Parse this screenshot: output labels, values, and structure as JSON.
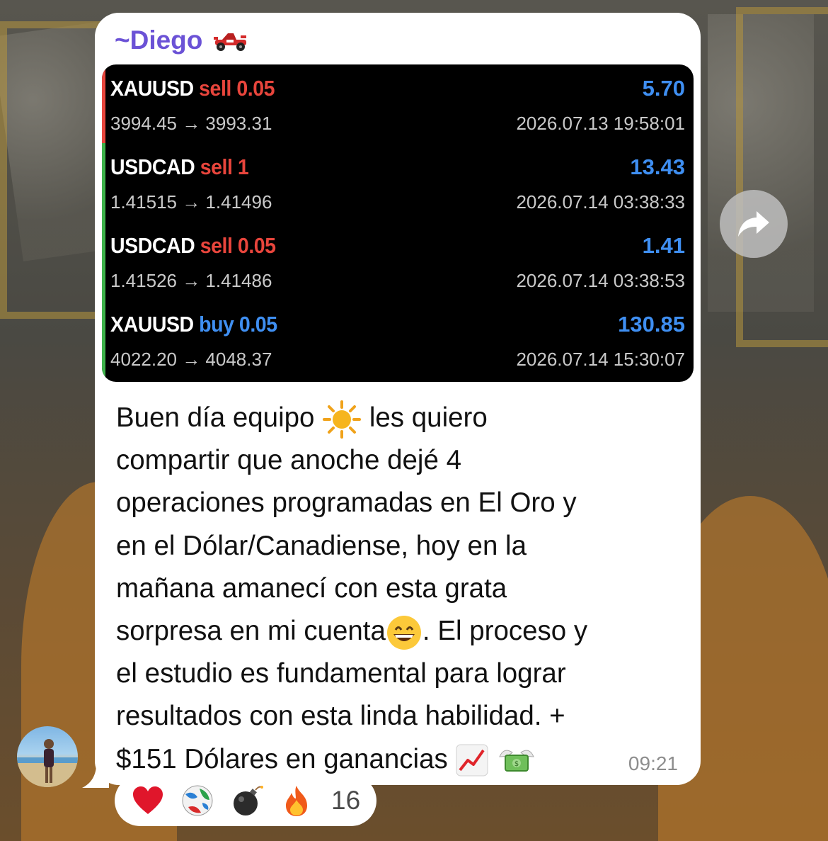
{
  "message": {
    "sender_prefix": "~",
    "sender": "Diego",
    "sender_emoji": "racing-car-icon",
    "time": "09:21",
    "text_lines": [
      "Buen día equipo ",
      " les quiero",
      "compartir que anoche dejé 4",
      "operaciones programadas en El Oro y",
      "en el Dólar/Canadiense, hoy en la",
      "mañana amanecí con esta grata",
      "sorpresa en mi cuenta",
      ". El proceso y",
      "el estudio es fundamental para lograr",
      "resultados con esta linda habilidad. +",
      "$151 Dólares en ganancias "
    ]
  },
  "trades": [
    {
      "symbol": "XAUUSD",
      "direction": "sell",
      "volume": "0.05",
      "prices": "3994.45 → 3993.31",
      "profit": "5.70",
      "time": "2026.07.13 19:58:01",
      "bar_color": "#e8453c"
    },
    {
      "symbol": "USDCAD",
      "direction": "sell",
      "volume": "1",
      "prices": "1.41515 → 1.41496",
      "profit": "13.43",
      "time": "2026.07.14 03:38:33",
      "bar_color": "#3db24a"
    },
    {
      "symbol": "USDCAD",
      "direction": "sell",
      "volume": "0.05",
      "prices": "1.41526 → 1.41486",
      "profit": "1.41",
      "time": "2026.07.14 03:38:53",
      "bar_color": "#3db24a"
    },
    {
      "symbol": "XAUUSD",
      "direction": "buy",
      "volume": "0.05",
      "prices": "4022.20 → 4048.37",
      "profit": "130.85",
      "time": "2026.07.14 15:30:07",
      "bar_color": "#3db24a"
    }
  ],
  "reactions": {
    "emojis": [
      "heart-icon",
      "ball-icon",
      "bomb-icon",
      "fire-icon"
    ],
    "count": "16"
  },
  "colors": {
    "sender": "#6b52d6",
    "sell": "#e8453c",
    "buy": "#3f8ff2"
  }
}
